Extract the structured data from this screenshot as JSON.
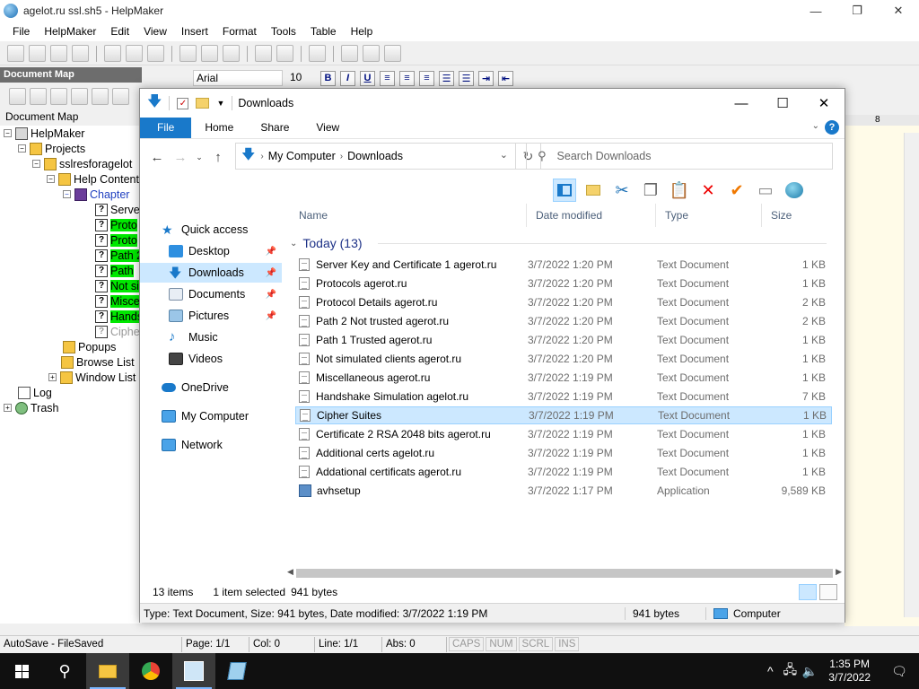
{
  "helpmaker": {
    "title": "agelot.ru ssl.sh5 - HelpMaker",
    "menu": [
      "File",
      "HelpMaker",
      "Edit",
      "View",
      "Insert",
      "Format",
      "Tools",
      "Table",
      "Help"
    ],
    "docmap_header": "Document Map",
    "docmap_label": "Document Map",
    "font": "Arial",
    "font_size": "10",
    "fmt_buttons": [
      "B",
      "I",
      "U"
    ],
    "tree": [
      {
        "label": "HelpMaker",
        "icon": "home"
      },
      {
        "label": "Projects",
        "icon": "folder"
      },
      {
        "label": "sslresforagelot",
        "icon": "folder"
      },
      {
        "label": "Help Contents",
        "icon": "folder"
      },
      {
        "label": "Chapter",
        "icon": "book"
      },
      {
        "label": "Serve",
        "icon": "topic"
      },
      {
        "label": "Proto",
        "icon": "topic"
      },
      {
        "label": "Proto",
        "icon": "topic"
      },
      {
        "label": "Path 2",
        "icon": "topic"
      },
      {
        "label": "Path",
        "icon": "topic"
      },
      {
        "label": "Not si",
        "icon": "topic"
      },
      {
        "label": "Misce",
        "icon": "topic"
      },
      {
        "label": "Hands",
        "icon": "topic"
      },
      {
        "label": "Ciphe",
        "icon": "topic"
      },
      {
        "label": "Popups",
        "icon": "folder"
      },
      {
        "label": "Browse List",
        "icon": "folder"
      },
      {
        "label": "Window List",
        "icon": "folder"
      },
      {
        "label": "Log",
        "icon": "log"
      },
      {
        "label": "Trash",
        "icon": "trash"
      }
    ],
    "ruler_mark": "8",
    "status": {
      "autosave": "AutoSave - FileSaved",
      "page": "Page: 1/1",
      "col": "Col: 0",
      "line": "Line: 1/1",
      "abs": "Abs: 0",
      "caps": "CAPS",
      "num": "NUM",
      "scrl": "SCRL",
      "ins": "INS"
    }
  },
  "explorer": {
    "title": "Downloads",
    "ribbon_tabs": [
      "File",
      "Home",
      "Share",
      "View"
    ],
    "help_glyph": "?",
    "address": [
      "My Computer",
      "Downloads"
    ],
    "search_placeholder": "Search Downloads",
    "nav": [
      {
        "label": "Quick access",
        "pinned": false
      },
      {
        "label": "Desktop",
        "pinned": true
      },
      {
        "label": "Downloads",
        "pinned": true
      },
      {
        "label": "Documents",
        "pinned": true
      },
      {
        "label": "Pictures",
        "pinned": true
      },
      {
        "label": "Music",
        "pinned": false
      },
      {
        "label": "Videos",
        "pinned": false
      },
      {
        "label": "OneDrive",
        "pinned": false
      },
      {
        "label": "My Computer",
        "pinned": false
      },
      {
        "label": "Network",
        "pinned": false
      }
    ],
    "columns": [
      "Name",
      "Date modified",
      "Type",
      "Size"
    ],
    "group": "Today (13)",
    "files": [
      {
        "name": "Server Key and Certificate 1 agerot.ru",
        "date": "3/7/2022 1:20 PM",
        "type": "Text Document",
        "size": "1 KB"
      },
      {
        "name": "Protocols agerot.ru",
        "date": "3/7/2022 1:20 PM",
        "type": "Text Document",
        "size": "1 KB"
      },
      {
        "name": "Protocol Details agerot.ru",
        "date": "3/7/2022 1:20 PM",
        "type": "Text Document",
        "size": "2 KB"
      },
      {
        "name": "Path 2 Not trusted agerot.ru",
        "date": "3/7/2022 1:20 PM",
        "type": "Text Document",
        "size": "2 KB"
      },
      {
        "name": "Path 1 Trusted agerot.ru",
        "date": "3/7/2022 1:20 PM",
        "type": "Text Document",
        "size": "1 KB"
      },
      {
        "name": "Not simulated clients agerot.ru",
        "date": "3/7/2022 1:20 PM",
        "type": "Text Document",
        "size": "1 KB"
      },
      {
        "name": "Miscellaneous agerot.ru",
        "date": "3/7/2022 1:19 PM",
        "type": "Text Document",
        "size": "1 KB"
      },
      {
        "name": "Handshake Simulation agelot.ru",
        "date": "3/7/2022 1:19 PM",
        "type": "Text Document",
        "size": "7 KB"
      },
      {
        "name": "Cipher Suites",
        "date": "3/7/2022 1:19 PM",
        "type": "Text Document",
        "size": "1 KB"
      },
      {
        "name": "Certificate 2 RSA 2048 bits agerot.ru",
        "date": "3/7/2022 1:19 PM",
        "type": "Text Document",
        "size": "1 KB"
      },
      {
        "name": "Additional certs agelot.ru",
        "date": "3/7/2022 1:19 PM",
        "type": "Text Document",
        "size": "1 KB"
      },
      {
        "name": "Addational certificats  agerot.ru",
        "date": "3/7/2022 1:19 PM",
        "type": "Text Document",
        "size": "1 KB"
      },
      {
        "name": "avhsetup",
        "date": "3/7/2022 1:17 PM",
        "type": "Application",
        "size": "9,589 KB"
      }
    ],
    "selected_index": 8,
    "status": {
      "count": "13 items",
      "selected": "1 item selected",
      "bytes": "941 bytes"
    },
    "details": {
      "info": "Type: Text Document, Size: 941 bytes, Date modified: 3/7/2022 1:19 PM",
      "size": "941 bytes",
      "location": "Computer"
    }
  },
  "taskbar": {
    "time": "1:35 PM",
    "date": "3/7/2022"
  },
  "colors": {
    "accent": "#1979ca",
    "selection": "#cce8ff",
    "highlight": "#00e800"
  }
}
